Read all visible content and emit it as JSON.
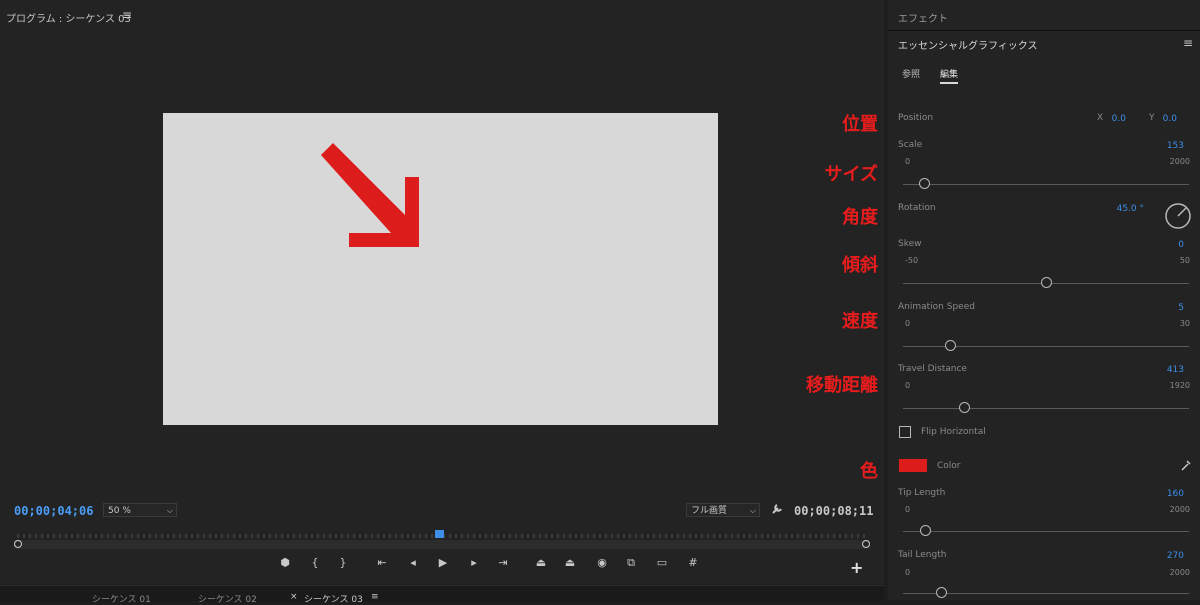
{
  "monitor": {
    "title": "プログラム : シーケンス 03",
    "timecode_current": "00;00;04;06",
    "timecode_duration": "00;00;08;11",
    "zoom": "50 %",
    "quality": "フル画質",
    "arrow_color": "#dd1c1c"
  },
  "bottom_tabs": [
    "シーケンス 01",
    "シーケンス 02",
    "シーケンス 03"
  ],
  "panel": {
    "effects_title": "エフェクト",
    "title": "エッセンシャルグラフィックス",
    "tabs": [
      "参照",
      "編集"
    ],
    "position": {
      "label": "Position",
      "x_label": "X",
      "x": "0.0",
      "y_label": "Y",
      "y": "0.0"
    },
    "scale": {
      "label": "Scale",
      "value": "153",
      "min": "0",
      "max": "2000",
      "level": 0.0765
    },
    "rotation": {
      "label": "Rotation",
      "value": "45.0 °"
    },
    "skew": {
      "label": "Skew",
      "value": "0",
      "min": "-50",
      "max": "50",
      "level": 0.5
    },
    "animation_speed": {
      "label": "Animation Speed",
      "value": "5",
      "min": "0",
      "max": "30",
      "level": 0.1667
    },
    "travel_distance": {
      "label": "Travel Distance",
      "value": "413",
      "min": "0",
      "max": "1920",
      "level": 0.215
    },
    "flip": {
      "label": "Flip Horizontal"
    },
    "color": {
      "label": "Color",
      "swatch": "#dd1c1c"
    },
    "tip_length": {
      "label": "Tip Length",
      "value": "160",
      "min": "0",
      "max": "2000",
      "level": 0.08
    },
    "tail_length": {
      "label": "Tail Length",
      "value": "270",
      "min": "0",
      "max": "2000",
      "level": 0.135
    }
  },
  "annotations": [
    "位置",
    "サイズ",
    "角度",
    "傾斜",
    "速度",
    "移動距離",
    "色"
  ],
  "icons": {
    "menu": "≡",
    "wrench": "🔧",
    "add": "+",
    "transport": [
      "marker-icon",
      "mark-in-icon",
      "mark-out-icon",
      "go-to-in-icon",
      "step-back-icon",
      "play-icon",
      "step-forward-icon",
      "go-to-out-icon",
      "lift-icon",
      "extract-icon",
      "camera-icon",
      "compare-icon",
      "safe-margins-icon",
      "grid-icon"
    ]
  }
}
